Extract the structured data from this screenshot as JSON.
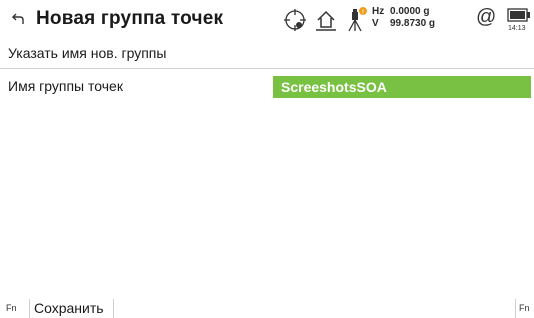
{
  "header": {
    "title": "Новая группа точек",
    "back_icon": "back-arrow-icon",
    "status": {
      "compass_icon": "crosshair-target-icon",
      "home_icon": "home-icon",
      "instrument_icon": "total-station-icon",
      "badge_color": "#f0a020",
      "hz_label": "Hz",
      "hz_value": "0.0000 g",
      "v_label": "V",
      "v_value": "99.8730 g",
      "at_symbol": "@",
      "battery_icon": "battery-icon",
      "time": "14:13"
    }
  },
  "main": {
    "subtitle": "Указать имя нов. группы",
    "field": {
      "label": "Имя группы точек",
      "value": "ScreeshotsSOA",
      "highlight_color": "#79c143"
    }
  },
  "footer": {
    "fn_left": "Fn",
    "save_label": "Сохранить",
    "fn_right": "Fn"
  }
}
